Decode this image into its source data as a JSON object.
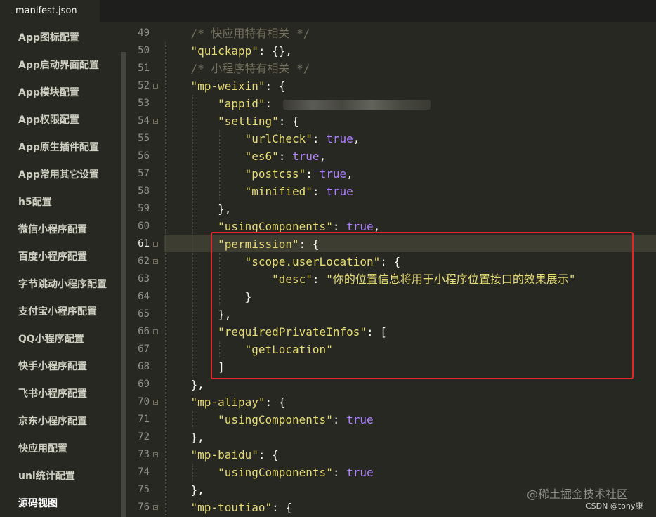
{
  "tab": {
    "title": "manifest.json"
  },
  "sidebar": {
    "items": [
      "App图标配置",
      "App启动界面配置",
      "App模块配置",
      "App权限配置",
      "App原生插件配置",
      "App常用其它设置",
      "h5配置",
      "微信小程序配置",
      "百度小程序配置",
      "字节跳动小程序配置",
      "支付宝小程序配置",
      "QQ小程序配置",
      "快手小程序配置",
      "飞书小程序配置",
      "京东小程序配置",
      "快应用配置",
      "uni统计配置",
      "源码视图"
    ],
    "active_index": 17
  },
  "editor": {
    "current_line": "61",
    "lines": [
      {
        "n": "49",
        "fold": false,
        "t": [
          [
            "i",
            "    "
          ],
          [
            "c",
            "/* 快应用特有相关 */"
          ]
        ]
      },
      {
        "n": "50",
        "fold": false,
        "t": [
          [
            "i",
            "    "
          ],
          [
            "s",
            "\"quickapp\""
          ],
          [
            "p",
            ": {},"
          ]
        ]
      },
      {
        "n": "51",
        "fold": false,
        "t": [
          [
            "i",
            "    "
          ],
          [
            "c",
            "/* 小程序特有相关 */"
          ]
        ]
      },
      {
        "n": "52",
        "fold": true,
        "t": [
          [
            "i",
            "    "
          ],
          [
            "s",
            "\"mp-weixin\""
          ],
          [
            "p",
            ": {"
          ]
        ]
      },
      {
        "n": "53",
        "fold": false,
        "t": [
          [
            "i",
            "        "
          ],
          [
            "s",
            "\"appid\""
          ],
          [
            "p",
            ":"
          ]
        ]
      },
      {
        "n": "54",
        "fold": true,
        "t": [
          [
            "i",
            "        "
          ],
          [
            "s",
            "\"setting\""
          ],
          [
            "p",
            ": {"
          ]
        ]
      },
      {
        "n": "55",
        "fold": false,
        "t": [
          [
            "i",
            "            "
          ],
          [
            "s",
            "\"urlCheck\""
          ],
          [
            "p",
            ": "
          ],
          [
            "k",
            "true"
          ],
          [
            "p",
            ","
          ]
        ]
      },
      {
        "n": "56",
        "fold": false,
        "t": [
          [
            "i",
            "            "
          ],
          [
            "s",
            "\"es6\""
          ],
          [
            "p",
            ": "
          ],
          [
            "k",
            "true"
          ],
          [
            "p",
            ","
          ]
        ]
      },
      {
        "n": "57",
        "fold": false,
        "t": [
          [
            "i",
            "            "
          ],
          [
            "s",
            "\"postcss\""
          ],
          [
            "p",
            ": "
          ],
          [
            "k",
            "true"
          ],
          [
            "p",
            ","
          ]
        ]
      },
      {
        "n": "58",
        "fold": false,
        "t": [
          [
            "i",
            "            "
          ],
          [
            "s",
            "\"minified\""
          ],
          [
            "p",
            ": "
          ],
          [
            "k",
            "true"
          ]
        ]
      },
      {
        "n": "59",
        "fold": false,
        "t": [
          [
            "i",
            "        "
          ],
          [
            "p",
            "},"
          ]
        ]
      },
      {
        "n": "60",
        "fold": false,
        "t": [
          [
            "i",
            "        "
          ],
          [
            "s",
            "\"usingComponents\""
          ],
          [
            "p",
            ": "
          ],
          [
            "k",
            "true"
          ],
          [
            "p",
            ","
          ]
        ]
      },
      {
        "n": "61",
        "fold": true,
        "t": [
          [
            "i",
            "        "
          ],
          [
            "s",
            "\"permission\""
          ],
          [
            "p",
            ": {"
          ]
        ]
      },
      {
        "n": "62",
        "fold": true,
        "t": [
          [
            "i",
            "            "
          ],
          [
            "s",
            "\"scope.userLocation\""
          ],
          [
            "p",
            ": {"
          ]
        ]
      },
      {
        "n": "63",
        "fold": false,
        "t": [
          [
            "i",
            "                "
          ],
          [
            "s",
            "\"desc\""
          ],
          [
            "p",
            ": "
          ],
          [
            "s",
            "\"你的位置信息将用于小程序位置接口的效果展示\""
          ]
        ]
      },
      {
        "n": "64",
        "fold": false,
        "t": [
          [
            "i",
            "            "
          ],
          [
            "p",
            "}"
          ]
        ]
      },
      {
        "n": "65",
        "fold": false,
        "t": [
          [
            "i",
            "        "
          ],
          [
            "p",
            "},"
          ]
        ]
      },
      {
        "n": "66",
        "fold": true,
        "t": [
          [
            "i",
            "        "
          ],
          [
            "s",
            "\"requiredPrivateInfos\""
          ],
          [
            "p",
            ": ["
          ]
        ]
      },
      {
        "n": "67",
        "fold": false,
        "t": [
          [
            "i",
            "            "
          ],
          [
            "s",
            "\"getLocation\""
          ]
        ]
      },
      {
        "n": "68",
        "fold": false,
        "t": [
          [
            "i",
            "        "
          ],
          [
            "p",
            "]"
          ]
        ]
      },
      {
        "n": "69",
        "fold": false,
        "t": [
          [
            "i",
            "    "
          ],
          [
            "p",
            "},"
          ]
        ]
      },
      {
        "n": "70",
        "fold": true,
        "t": [
          [
            "i",
            "    "
          ],
          [
            "s",
            "\"mp-alipay\""
          ],
          [
            "p",
            ": {"
          ]
        ]
      },
      {
        "n": "71",
        "fold": false,
        "t": [
          [
            "i",
            "        "
          ],
          [
            "s",
            "\"usingComponents\""
          ],
          [
            "p",
            ": "
          ],
          [
            "k",
            "true"
          ]
        ]
      },
      {
        "n": "72",
        "fold": false,
        "t": [
          [
            "i",
            "    "
          ],
          [
            "p",
            "},"
          ]
        ]
      },
      {
        "n": "73",
        "fold": true,
        "t": [
          [
            "i",
            "    "
          ],
          [
            "s",
            "\"mp-baidu\""
          ],
          [
            "p",
            ": {"
          ]
        ]
      },
      {
        "n": "74",
        "fold": false,
        "t": [
          [
            "i",
            "        "
          ],
          [
            "s",
            "\"usingComponents\""
          ],
          [
            "p",
            ": "
          ],
          [
            "k",
            "true"
          ]
        ]
      },
      {
        "n": "75",
        "fold": false,
        "t": [
          [
            "i",
            "    "
          ],
          [
            "p",
            "},"
          ]
        ]
      },
      {
        "n": "76",
        "fold": true,
        "t": [
          [
            "i",
            "    "
          ],
          [
            "s",
            "\"mp-toutiao\""
          ],
          [
            "p",
            ": {"
          ]
        ]
      }
    ]
  },
  "watermark": {
    "main": "@稀土掘金技术社区",
    "sub": "CSDN @tony康"
  },
  "colors": {
    "background": "#272822",
    "string": "#e6db74",
    "keyword": "#ae81ff",
    "comment": "#75715e",
    "highlight_box": "#e3262c"
  }
}
